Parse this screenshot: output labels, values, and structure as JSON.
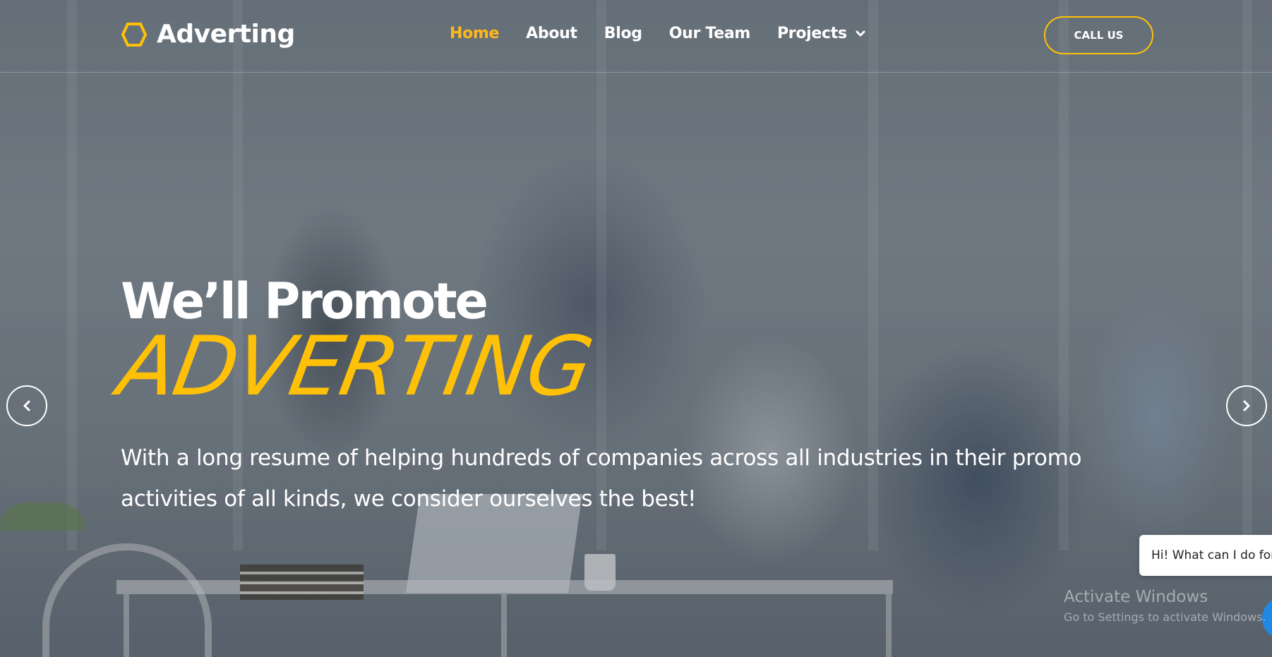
{
  "brand": {
    "name": "Adverting",
    "logo_icon": "hexagon-icon",
    "accent_color": "#ffc107"
  },
  "nav": {
    "items": [
      {
        "label": "Home",
        "active": true
      },
      {
        "label": "About",
        "active": false
      },
      {
        "label": "Blog",
        "active": false
      },
      {
        "label": "Our Team",
        "active": false
      },
      {
        "label": "Projects",
        "active": false,
        "icon": "chevron-down-icon"
      }
    ]
  },
  "header": {
    "call_button": "CALL US"
  },
  "hero": {
    "title": "We’ll Promote",
    "script_title": "ADVERTING",
    "description": "With a long resume of helping hundreds of companies across all industries in their promo activities of all kinds, we consider ourselves the best!"
  },
  "slider": {
    "prev_icon": "chevron-left-icon",
    "next_icon": "chevron-right-icon"
  },
  "chat": {
    "greeting": "Hi! What can I do for you?"
  },
  "os_watermark": {
    "line1": "Activate Windows",
    "line2": "Go to Settings to activate Windows."
  }
}
